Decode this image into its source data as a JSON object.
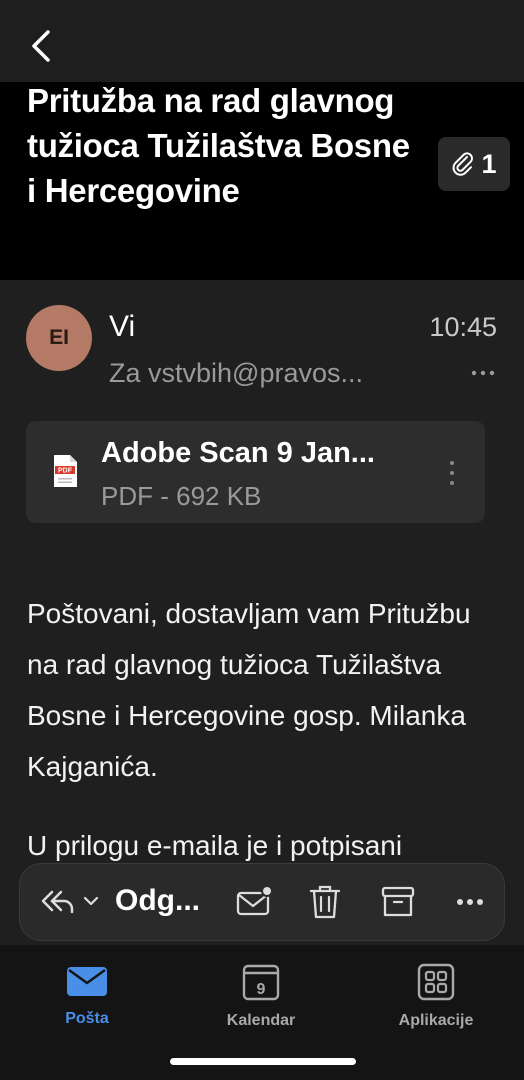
{
  "email": {
    "subject": "Pritužba na rad glavnog tužioca Tužilaštva Bosne i Hercegovine",
    "attachment_count": "1",
    "avatar_initials": "EI",
    "sender": "Vi",
    "time": "10:45",
    "recipients": "Za vstvbih@pravos...",
    "attachment": {
      "name": "Adobe Scan 9 Jan...",
      "meta": "PDF - 692 KB"
    },
    "body": {
      "paragraph1": "Poštovani, dostavljam vam Pritužbu na rad glavnog tužioca Tužilaštva Bosne i Hercegovine gosp. Milanka Kajganića.",
      "paragraph2": "U prilogu e-maila je i potpisani"
    }
  },
  "action_bar": {
    "reply_label": "Odg..."
  },
  "tabs": [
    {
      "label": "Pošta"
    },
    {
      "label": "Kalendar",
      "day": "9"
    },
    {
      "label": "Aplikacije"
    }
  ],
  "colors": {
    "accent": "#4a8fe7",
    "avatar": "#b47a66",
    "background": "#1f1f1f"
  }
}
